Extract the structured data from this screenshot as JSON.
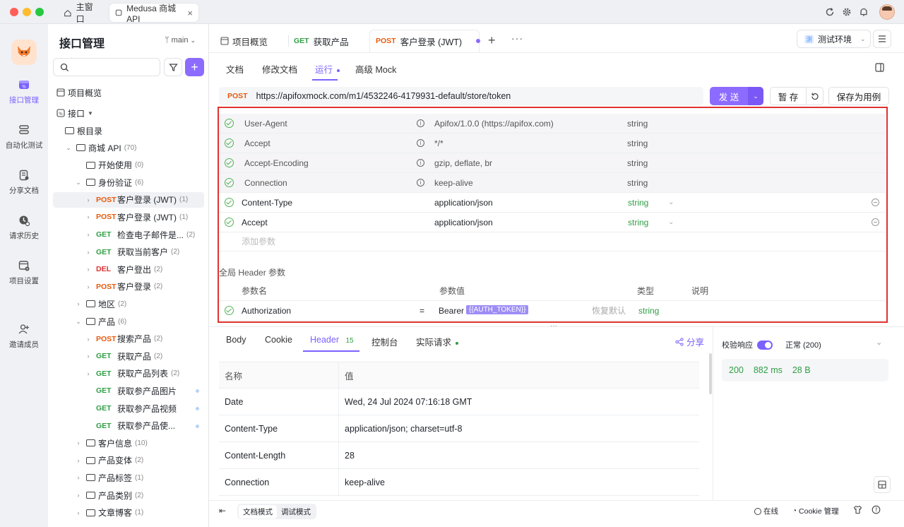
{
  "titlebar": {
    "home_tab": "主窗口",
    "project_tab": "Medusa 商城 API",
    "colors": {
      "close": "#ff5f57",
      "min": "#febc2e",
      "max": "#28c840"
    }
  },
  "rail": {
    "items": [
      {
        "label": "接口管理",
        "icon": "api-icon"
      },
      {
        "label": "自动化测试",
        "icon": "automation-icon"
      },
      {
        "label": "分享文档",
        "icon": "share-doc-icon"
      },
      {
        "label": "请求历史",
        "icon": "history-icon"
      },
      {
        "label": "项目设置",
        "icon": "settings-icon"
      },
      {
        "label": "邀请成员",
        "icon": "invite-icon"
      }
    ]
  },
  "sidebar": {
    "title": "接口管理",
    "branch": "main",
    "overview": "项目概览",
    "api_section": "接口",
    "root": "根目录",
    "tree": [
      {
        "kind": "folder",
        "label": "商城 API",
        "count": "(70)",
        "indent": 1,
        "caret": "⌄"
      },
      {
        "kind": "folder",
        "label": "开始使用",
        "count": "(0)",
        "indent": 2,
        "caret": ""
      },
      {
        "kind": "folder",
        "label": "身份验证",
        "count": "(6)",
        "indent": 2,
        "caret": "⌄"
      },
      {
        "kind": "api",
        "method": "POST",
        "label": "客户登录 (JWT)",
        "count": "(1)",
        "indent": 3,
        "caret": "›",
        "selected": true
      },
      {
        "kind": "api",
        "method": "POST",
        "label": "客户登录 (JWT)",
        "count": "(1)",
        "indent": 3,
        "caret": "›"
      },
      {
        "kind": "api",
        "method": "GET",
        "label": "检查电子邮件是...",
        "count": "(2)",
        "indent": 3,
        "caret": "›"
      },
      {
        "kind": "api",
        "method": "GET",
        "label": "获取当前客户",
        "count": "(2)",
        "indent": 3,
        "caret": "›"
      },
      {
        "kind": "api",
        "method": "DEL",
        "label": "客户登出",
        "count": "(2)",
        "indent": 3,
        "caret": "›"
      },
      {
        "kind": "api",
        "method": "POST",
        "label": "客户登录",
        "count": "(2)",
        "indent": 3,
        "caret": "›"
      },
      {
        "kind": "folder",
        "label": "地区",
        "count": "(2)",
        "indent": 2,
        "caret": "›"
      },
      {
        "kind": "folder",
        "label": "产品",
        "count": "(6)",
        "indent": 2,
        "caret": "⌄"
      },
      {
        "kind": "api",
        "method": "POST",
        "label": "搜索产品",
        "count": "(2)",
        "indent": 3,
        "caret": "›"
      },
      {
        "kind": "api",
        "method": "GET",
        "label": "获取产品",
        "count": "(2)",
        "indent": 3,
        "caret": "›"
      },
      {
        "kind": "api",
        "method": "GET",
        "label": "获取产品列表",
        "count": "(2)",
        "indent": 3,
        "caret": "›"
      },
      {
        "kind": "api",
        "method": "GET",
        "label": "获取参产品图片",
        "count": "",
        "indent": 3,
        "caret": "",
        "dot": true
      },
      {
        "kind": "api",
        "method": "GET",
        "label": "获取参产品视频",
        "count": "",
        "indent": 3,
        "caret": "",
        "dot": true
      },
      {
        "kind": "api",
        "method": "GET",
        "label": "获取参产品使...",
        "count": "",
        "indent": 3,
        "caret": "",
        "dot": true
      },
      {
        "kind": "folder",
        "label": "客户信息",
        "count": "(10)",
        "indent": 2,
        "caret": "›"
      },
      {
        "kind": "folder",
        "label": "产品变体",
        "count": "(2)",
        "indent": 2,
        "caret": "›"
      },
      {
        "kind": "folder",
        "label": "产品标签",
        "count": "(1)",
        "indent": 2,
        "caret": "›"
      },
      {
        "kind": "folder",
        "label": "产品类别",
        "count": "(2)",
        "indent": 2,
        "caret": "›"
      },
      {
        "kind": "folder",
        "label": "文章博客",
        "count": "(1)",
        "indent": 2,
        "caret": "›"
      }
    ]
  },
  "header_tabs": {
    "overview": "项目概览",
    "get_method": "GET",
    "get_label": "获取产品",
    "post_method": "POST",
    "post_label": "客户登录 (JWT)",
    "env": "测试环境",
    "env_badge": "测"
  },
  "sub_tabs": {
    "doc": "文档",
    "edit": "修改文档",
    "run": "运行",
    "mock": "高级 Mock"
  },
  "request": {
    "method": "POST",
    "url": "https://apifoxmock.com/m1/4532246-4179931-default/store/token",
    "send": "发 送",
    "save_temp": "暂 存",
    "save_case": "保存为用例"
  },
  "headers": {
    "auto": [
      {
        "name": "User-Agent",
        "value": "Apifox/1.0.0 (https://apifox.com)",
        "type": "string"
      },
      {
        "name": "Accept",
        "value": "*/*",
        "type": "string"
      },
      {
        "name": "Accept-Encoding",
        "value": "gzip, deflate, br",
        "type": "string"
      },
      {
        "name": "Connection",
        "value": "keep-alive",
        "type": "string"
      }
    ],
    "custom": [
      {
        "name": "Content-Type",
        "value": "application/json",
        "type": "string"
      },
      {
        "name": "Accept",
        "value": "application/json",
        "type": "string"
      }
    ],
    "add_placeholder": "添加参数",
    "global_title": "全局 Header 参数",
    "col_name": "参数名",
    "col_value": "参数值",
    "col_type": "类型",
    "col_desc": "说明",
    "global_row": {
      "name": "Authorization",
      "eq": "=",
      "value": "Bearer",
      "token": "{{AUTH_TOKEN}}",
      "restore": "恢复默认",
      "type": "string"
    }
  },
  "response": {
    "tabs": {
      "body": "Body",
      "cookie": "Cookie",
      "header": "Header",
      "header_count": "15",
      "console": "控制台",
      "actual": "实际请求"
    },
    "share": "分享",
    "col_name": "名称",
    "col_value": "值",
    "rows": [
      {
        "name": "Date",
        "value": "Wed, 24 Jul 2024 07:16:18 GMT"
      },
      {
        "name": "Content-Type",
        "value": "application/json; charset=utf-8"
      },
      {
        "name": "Content-Length",
        "value": "28"
      },
      {
        "name": "Connection",
        "value": "keep-alive"
      }
    ],
    "validate": "校验响应",
    "status_text": "正常 (200)",
    "status_code": "200",
    "time": "882 ms",
    "size": "28 B"
  },
  "footer": {
    "doc_mode": "文档模式",
    "debug_mode": "调试模式",
    "online": "在线",
    "cookie_mgr": "Cookie 管理"
  }
}
